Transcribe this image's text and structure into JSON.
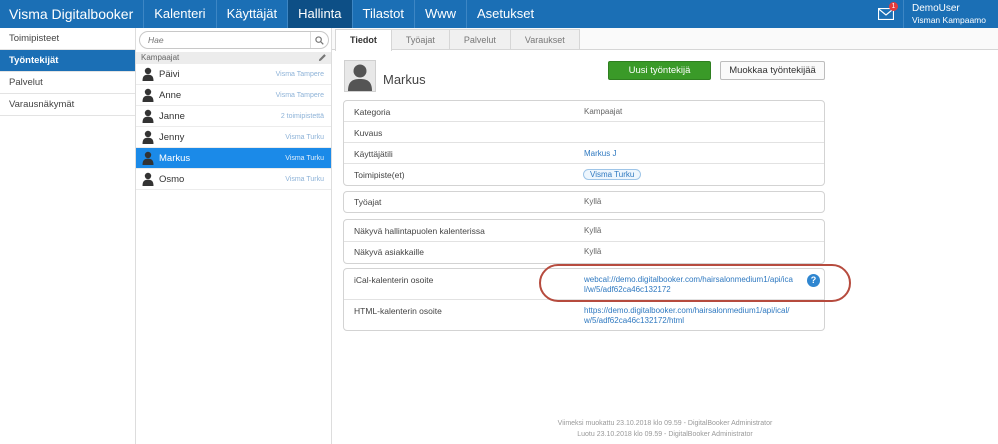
{
  "topbar": {
    "brand": "Visma Digitalbooker",
    "nav": [
      {
        "label": "Kalenteri",
        "active": false
      },
      {
        "label": "Käyttäjät",
        "active": false
      },
      {
        "label": "Hallinta",
        "active": true
      },
      {
        "label": "Tilastot",
        "active": false
      },
      {
        "label": "Www",
        "active": false
      },
      {
        "label": "Asetukset",
        "active": false
      }
    ],
    "mail_badge": "1",
    "user_name": "DemoUser",
    "user_company": "Visman Kampaamo"
  },
  "sidebar": {
    "items": [
      {
        "label": "Toimipisteet",
        "active": false
      },
      {
        "label": "Työntekijät",
        "active": true
      },
      {
        "label": "Palvelut",
        "active": false
      },
      {
        "label": "Varausnäkymät",
        "active": false
      }
    ]
  },
  "employees": {
    "search_placeholder": "Hae",
    "group": "Kampaajat",
    "list": [
      {
        "name": "Päivi",
        "location": "Visma Tampere",
        "active": false
      },
      {
        "name": "Anne",
        "location": "Visma Tampere",
        "active": false
      },
      {
        "name": "Janne",
        "location": "2 toimipistettä",
        "active": false
      },
      {
        "name": "Jenny",
        "location": "Visma Turku",
        "active": false
      },
      {
        "name": "Markus",
        "location": "Visma Turku",
        "active": true
      },
      {
        "name": "Osmo",
        "location": "Visma Turku",
        "active": false
      }
    ]
  },
  "main": {
    "tabs": [
      {
        "label": "Tiedot",
        "active": true
      },
      {
        "label": "Työajat",
        "active": false
      },
      {
        "label": "Palvelut",
        "active": false
      },
      {
        "label": "Varaukset",
        "active": false
      }
    ],
    "profile_name": "Markus",
    "new_button": "Uusi työntekijä",
    "edit_button": "Muokkaa työntekijää",
    "details": {
      "kategoria_label": "Kategoria",
      "kategoria_value": "Kampaajat",
      "kuvaus_label": "Kuvaus",
      "kayttajatili_label": "Käyttäjätili",
      "kayttajatili_value": "Markus J",
      "toimipiste_label": "Toimipiste(et)",
      "toimipiste_value": "Visma Turku"
    },
    "tyoajat": {
      "label": "Työajat",
      "value": "Kyllä"
    },
    "visibility": {
      "hallinta_label": "Näkyvä hallintapuolen kalenterissa",
      "hallinta_value": "Kyllä",
      "asiakkaat_label": "Näkyvä asiakkaille",
      "asiakkaat_value": "Kyllä"
    },
    "calendar": {
      "ical_label": "iCal-kalenterin osoite",
      "ical_url": "webcal://demo.digitalbooker.com/hairsalonmedium1/api/ical/w/5/adf62ca46c132172",
      "help_icon_text": "?",
      "html_label": "HTML-kalenterin osoite",
      "html_url": "https://demo.digitalbooker.com/hairsalonmedium1/api/ical/w/5/adf62ca46c132172/html"
    },
    "footer": {
      "modified": "Viimeksi muokattu 23.10.2018 klo 09.59 - DigitalBooker Administrator",
      "created": "Luotu 23.10.2018 klo 09.59 - DigitalBooker Administrator"
    }
  },
  "colors": {
    "topbar": "#1b6fb5",
    "nav_active": "#0d4f86",
    "list_active": "#1b8ae8",
    "primary_button": "#3a9a28",
    "highlight_ring": "#b64b3e"
  }
}
